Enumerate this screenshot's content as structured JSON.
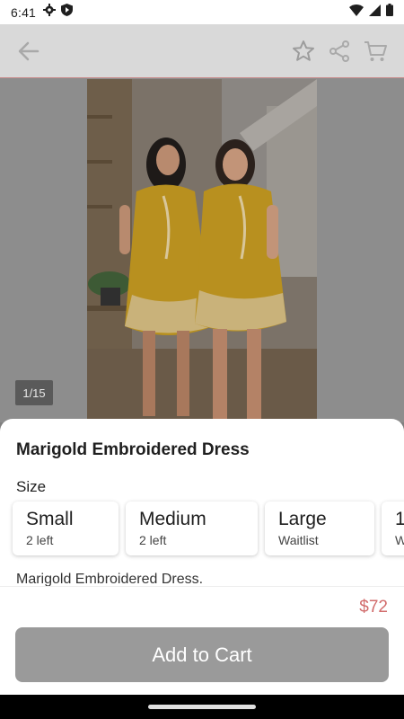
{
  "status_bar": {
    "time": "6:41",
    "left_icons": [
      "settings-icon",
      "shield-icon"
    ],
    "right_icons": [
      "wifi-icon",
      "cell-signal-icon",
      "battery-icon"
    ]
  },
  "app_bar": {
    "icons": [
      "back-arrow-icon",
      "star-icon",
      "share-icon",
      "cart-icon"
    ]
  },
  "gallery": {
    "counter": "1/15"
  },
  "product": {
    "title": "Marigold Embroidered Dress",
    "size_label": "Size",
    "sizes": [
      {
        "name": "Small",
        "availability": "2 left"
      },
      {
        "name": "Medium",
        "availability": "2 left"
      },
      {
        "name": "Large",
        "availability": "Waitlist"
      },
      {
        "name": "1",
        "availability": "W"
      }
    ],
    "description": "Marigold Embroidered Dress.",
    "price": "$72"
  },
  "actions": {
    "add_to_cart_label": "Add to Cart"
  },
  "colors": {
    "price": "#d16b6b",
    "button": "#9a9a9a",
    "dress": "#d9a628"
  }
}
